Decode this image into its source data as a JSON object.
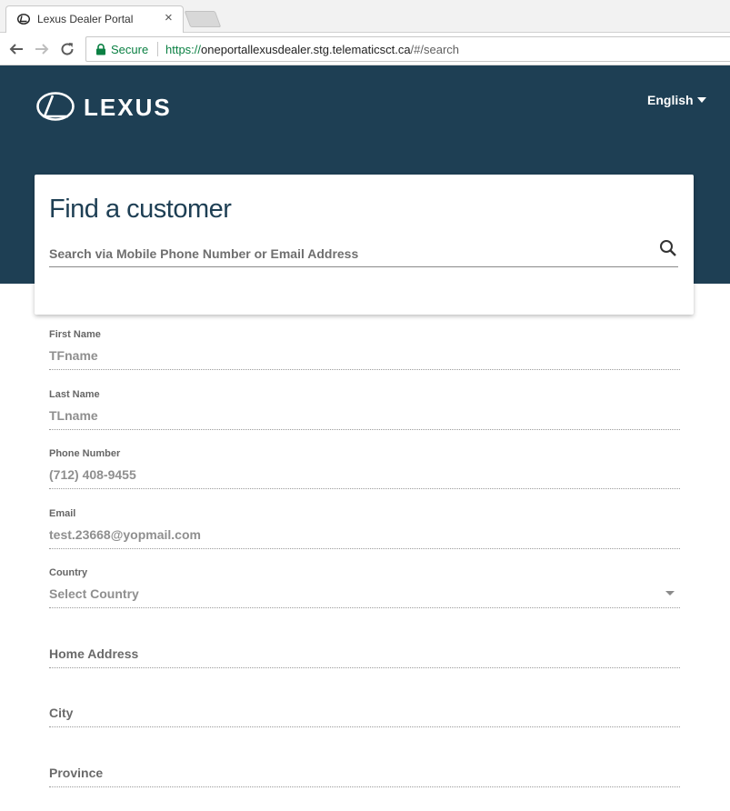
{
  "browser": {
    "tab_title": "Lexus Dealer Portal",
    "tab_close": "×",
    "secure_label": "Secure",
    "url_scheme": "https://",
    "url_host": "oneportallexusdealer.stg.telematicsct.ca",
    "url_path": "/#/search"
  },
  "header": {
    "brand": "LEXUS",
    "language": "English",
    "background_color": "#1e3f54"
  },
  "search": {
    "title": "Find a customer",
    "placeholder": "Search via Mobile Phone Number or Email Address",
    "icon": "search-icon"
  },
  "form": {
    "first_name": {
      "label": "First Name",
      "value": "TFname"
    },
    "last_name": {
      "label": "Last Name",
      "value": "TLname"
    },
    "phone": {
      "label": "Phone Number",
      "value": "(712) 408-9455"
    },
    "email": {
      "label": "Email",
      "value": "test.23668@yopmail.com"
    },
    "country": {
      "label": "Country",
      "value": "Select Country"
    },
    "home_address": {
      "placeholder": "Home Address"
    },
    "city": {
      "placeholder": "City"
    },
    "province": {
      "placeholder": "Province"
    }
  }
}
